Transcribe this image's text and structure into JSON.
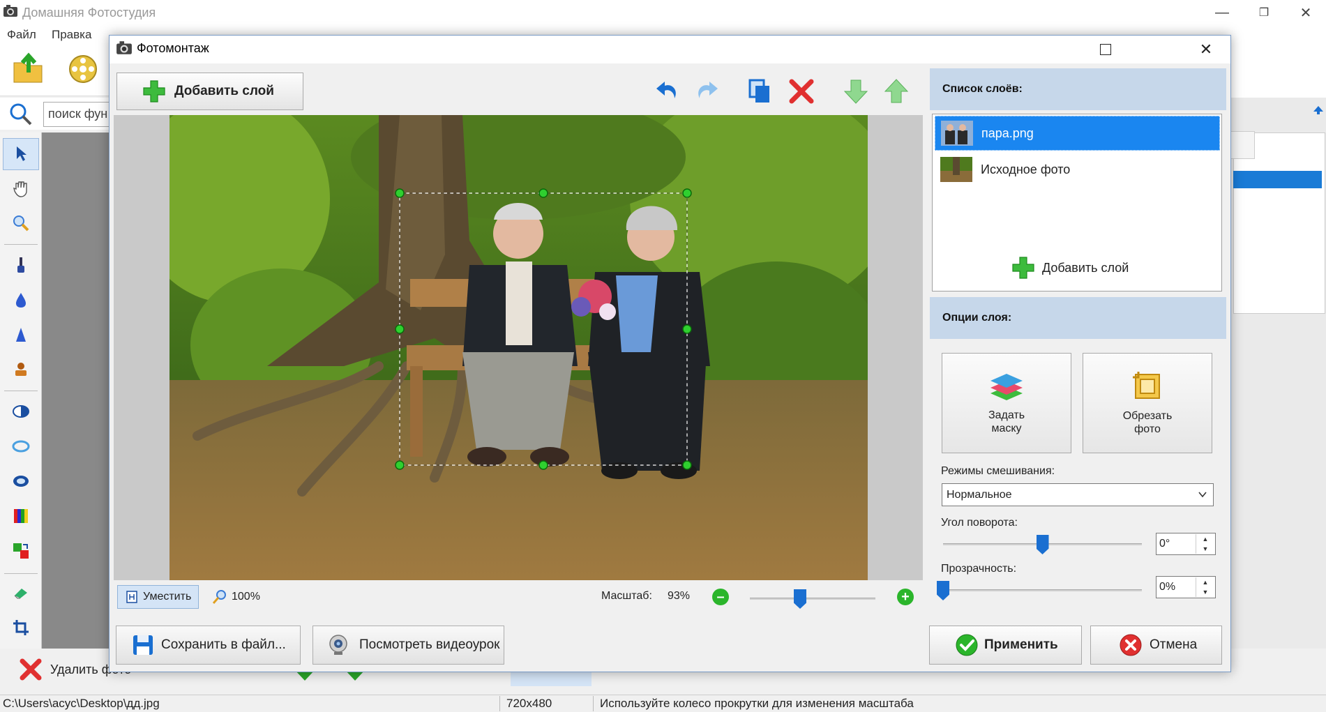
{
  "main_window": {
    "title": "Домашняя Фотостудия",
    "menu": [
      "Файл",
      "Правка"
    ],
    "search_placeholder": "поиск фун",
    "delete_photo": "Удалить фото",
    "status": {
      "path": "C:\\Users\\асус\\Desktop\\дд.jpg",
      "size": "720x480",
      "hint": "Используйте колесо прокрутки для изменения масштаба"
    }
  },
  "dialog": {
    "title": "Фотомонтаж",
    "add_layer": "Добавить слой",
    "zoom": {
      "fit": "Уместить",
      "hundred": "100%",
      "label": "Масштаб:",
      "value": "93%",
      "level": 0.4
    },
    "layers_panel": {
      "header": "Список слоёв:",
      "items": [
        {
          "label": "пара.png",
          "selected": true
        },
        {
          "label": "Исходное фото",
          "selected": false
        }
      ],
      "add_layer": "Добавить слой"
    },
    "options_panel": {
      "header": "Опции слоя:",
      "mask_button": "Задать маску",
      "crop_button": "Обрезать фото",
      "blend_label": "Режимы смешивания:",
      "blend_value": "Нормальное",
      "rotation_label": "Угол поворота:",
      "rotation_value": "0°",
      "rotation_level": 0.5,
      "opacity_label": "Прозрачность:",
      "opacity_value": "0%",
      "opacity_level": 0
    },
    "footer": {
      "save": "Сохранить в файл...",
      "video": "Посмотреть видеоурок",
      "apply": "Применить",
      "cancel": "Отмена"
    }
  },
  "colors": {
    "accent": "#1a86f0",
    "panel_header": "#c6d7ea",
    "green": "#2bb52b",
    "red": "#e03030"
  }
}
